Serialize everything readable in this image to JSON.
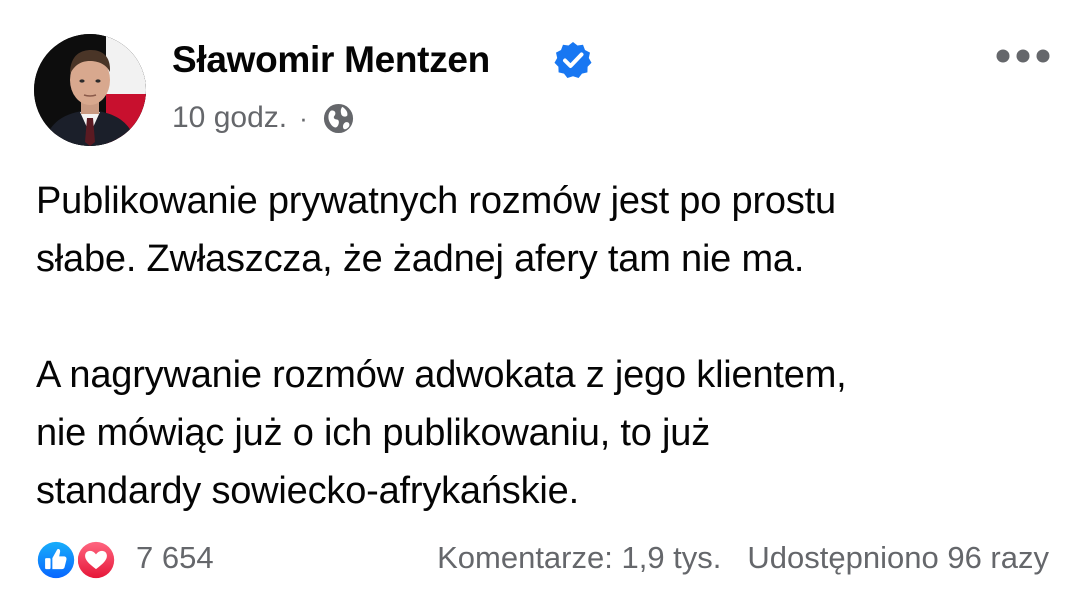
{
  "post": {
    "author": "Sławomir Mentzen",
    "time": "10 godz.",
    "separator": "·",
    "audience_icon": "globe-icon",
    "verified_icon": "verified-badge-icon",
    "more_icon": "more-options-icon",
    "text": {
      "paragraph1_line1": "Publikowanie prywatnych rozmów jest po prostu",
      "paragraph1_line2": "słabe. Zwłaszcza, że żadnej afery tam nie ma.",
      "paragraph2_line1": "A nagrywanie rozmów adwokata z jego klientem,",
      "paragraph2_line2": "nie mówiąc już o ich publikowaniu, to już",
      "paragraph2_line3": "standardy sowiecko-afrykańskie."
    }
  },
  "footer": {
    "reaction_icons": [
      "like-icon",
      "love-icon"
    ],
    "reaction_count": "7 654",
    "comments": "Komentarze: 1,9 tys.",
    "shares": "Udostępniono 96 razy"
  },
  "colors": {
    "text_primary": "#050505",
    "text_secondary": "#65676b",
    "verified_blue": "#1877f2",
    "like_blue": "#1877f2",
    "love_red": "#f33e58"
  }
}
